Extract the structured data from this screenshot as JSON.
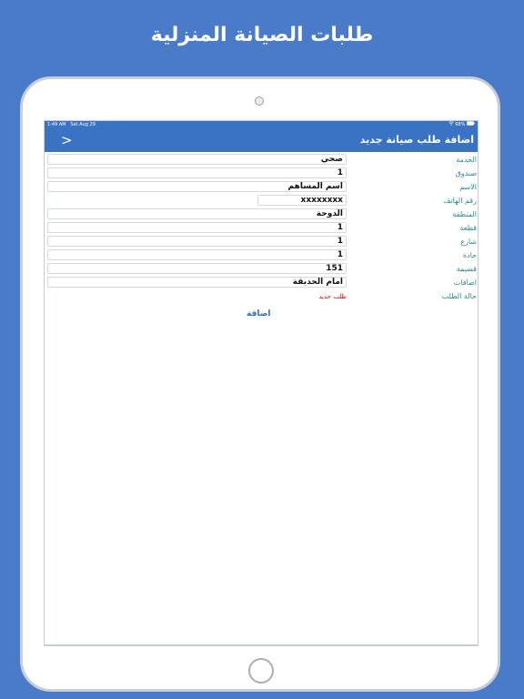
{
  "headline": "طلبات الصيانة المنزلية",
  "status_bar": {
    "time": "1:49 AM",
    "date": "Sat Aug 29",
    "battery": "98%"
  },
  "nav": {
    "title": "اضافة طلب صيانة جديد",
    "back_label": ">"
  },
  "form": {
    "fields": [
      {
        "label": "الخدمة",
        "value": "صحي"
      },
      {
        "label": "صندوق",
        "value": "1"
      },
      {
        "label": "الاسم",
        "value": "اسم المساهم"
      },
      {
        "label": "رقم الهاتف",
        "value": "xxxxxxxx"
      },
      {
        "label": "المنطقة",
        "value": "الدوحة"
      },
      {
        "label": "قطعة",
        "value": "1"
      },
      {
        "label": "شارع",
        "value": "1"
      },
      {
        "label": "جادة",
        "value": "1"
      },
      {
        "label": "قسيمة",
        "value": "151"
      },
      {
        "label": "اضافات",
        "value": "امام الحديقة"
      }
    ],
    "status": {
      "label": "حالة الطلب",
      "value": "طلب جديد"
    },
    "add_label": "اضافة"
  },
  "colors": {
    "background": "#4a7bc8",
    "nav_bar": "#3b73c4",
    "label": "#2f8a8a",
    "status": "#b01818",
    "link": "#2f6fc5"
  },
  "icons": {
    "back": "chevron-left-icon",
    "wifi": "wifi-icon",
    "battery": "battery-icon"
  }
}
